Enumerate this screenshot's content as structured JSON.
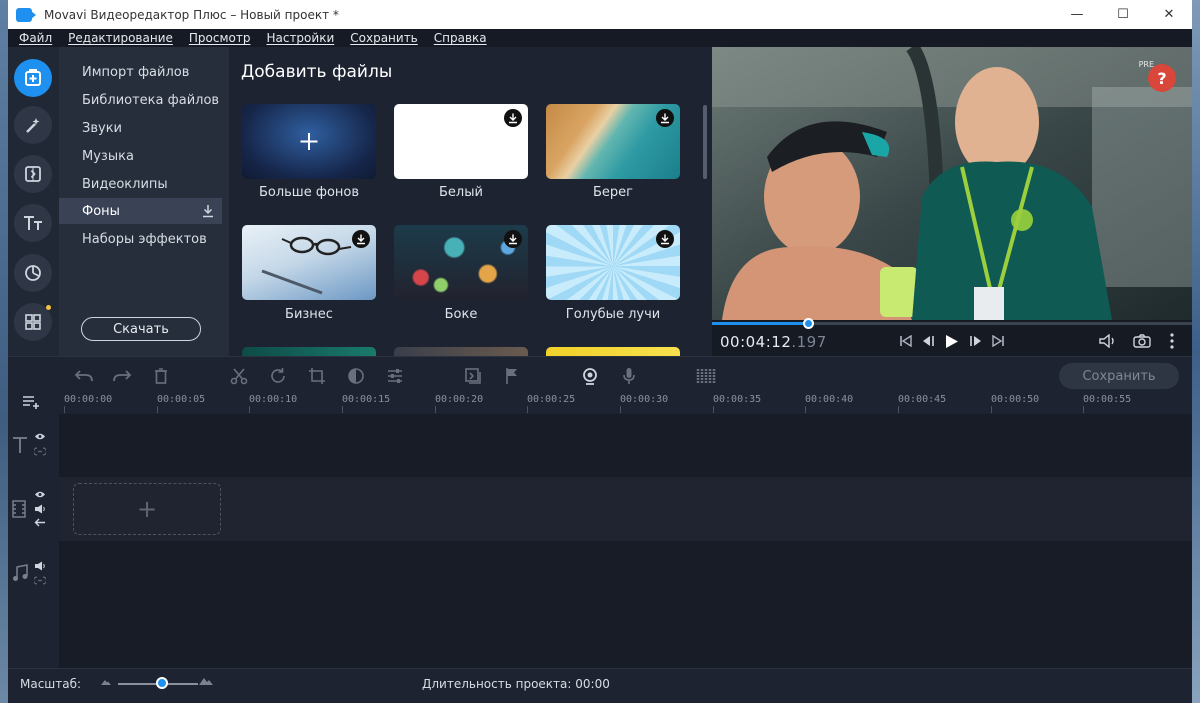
{
  "window": {
    "title": "Movavi Видеоредактор Плюс – Новый проект *",
    "minimize_glyph": "—",
    "maximize_glyph": "☐",
    "close_glyph": "✕"
  },
  "menu": [
    "Файл",
    "Редактирование",
    "Просмотр",
    "Настройки",
    "Сохранить",
    "Справка"
  ],
  "rail": [
    {
      "name": "import-icon",
      "active": true
    },
    {
      "name": "magic-wand-icon",
      "active": false
    },
    {
      "name": "transitions-icon",
      "active": false
    },
    {
      "name": "titles-icon",
      "active": false
    },
    {
      "name": "stickers-icon",
      "active": false
    },
    {
      "name": "more-tools-icon",
      "active": false
    }
  ],
  "categories": {
    "items": [
      "Импорт файлов",
      "Библиотека файлов",
      "Звуки",
      "Музыка",
      "Видеоклипы",
      "Фоны",
      "Наборы эффектов"
    ],
    "selected_index": 5,
    "download_label": "Скачать"
  },
  "content": {
    "title": "Добавить файлы",
    "tiles": [
      {
        "label": "Больше фонов",
        "kind": "more",
        "download": false
      },
      {
        "label": "Белый",
        "kind": "white",
        "download": true
      },
      {
        "label": "Берег",
        "kind": "shore",
        "download": true
      },
      {
        "label": "Бизнес",
        "kind": "business",
        "download": true
      },
      {
        "label": "Боке",
        "kind": "bokeh",
        "download": true
      },
      {
        "label": "Голубые лучи",
        "kind": "rays",
        "download": true
      }
    ]
  },
  "preview": {
    "help_label": "?",
    "watermark": "PRE",
    "timecode_main": "00:04:12",
    "timecode_ms": ".197",
    "progress": 0.2
  },
  "toolbar": {
    "save_label": "Сохранить"
  },
  "ruler": [
    "00:00:00",
    "00:00:05",
    "00:00:10",
    "00:00:15",
    "00:00:20",
    "00:00:25",
    "00:00:30",
    "00:00:35",
    "00:00:40",
    "00:00:45",
    "00:00:50",
    "00:00:55"
  ],
  "timeline": {
    "drop_plus": "+"
  },
  "status": {
    "zoom_label": "Масштаб:",
    "zoom_level": 0.55,
    "duration_label": "Длительность проекта:",
    "duration_value": "00:00"
  },
  "colors": {
    "accent": "#1e90ef",
    "help": "#d9463a",
    "background": "#1d2330"
  }
}
